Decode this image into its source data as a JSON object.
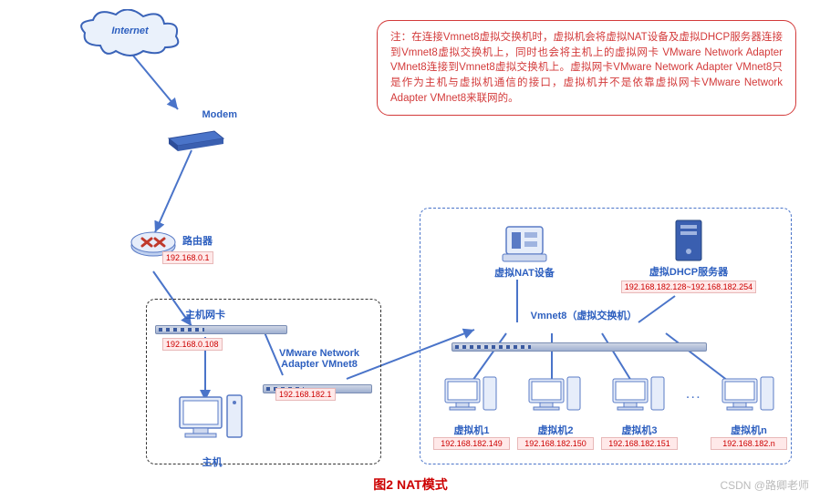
{
  "internet_label": "Internet",
  "modem_label": "Modem",
  "router": {
    "label": "路由器",
    "ip": "192.168.0.1"
  },
  "host_nic": {
    "label": "主机网卡",
    "ip": "192.168.0.108"
  },
  "vmnet_adapter": {
    "label_l1": "VMware Network",
    "label_l2": "Adapter VMnet8",
    "ip": "192.168.182.1"
  },
  "host_label": "主机",
  "virtual_nat_label": "虚拟NAT设备",
  "virtual_dhcp": {
    "label": "虚拟DHCP服务器",
    "ip": "192.168.182.128~192.168.182.254"
  },
  "vmnet8_switch_label": "Vmnet8（虚拟交换机）",
  "vms": [
    {
      "label": "虚拟机1",
      "ip": "192.168.182.149"
    },
    {
      "label": "虚拟机2",
      "ip": "192.168.182.150"
    },
    {
      "label": "虚拟机3",
      "ip": "192.168.182.151"
    },
    {
      "label": "虚拟机n",
      "ip": "192.168.182.n"
    }
  ],
  "callout_text": "注：在连接Vmnet8虚拟交换机时，虚拟机会将虚拟NAT设备及虚拟DHCP服务器连接到Vmnet8虚拟交换机上，同时也会将主机上的虚拟网卡 VMware Network Adapter VMnet8连接到Vmnet8虚拟交换机上。虚拟网卡VMware Network Adapter VMnet8只是作为主机与虚拟机通信的接口，虚拟机并不是依靠虚拟网卡VMware Network Adapter VMnet8来联网的。",
  "caption": "图2 NAT模式",
  "watermark": "CSDN @路卿老师"
}
